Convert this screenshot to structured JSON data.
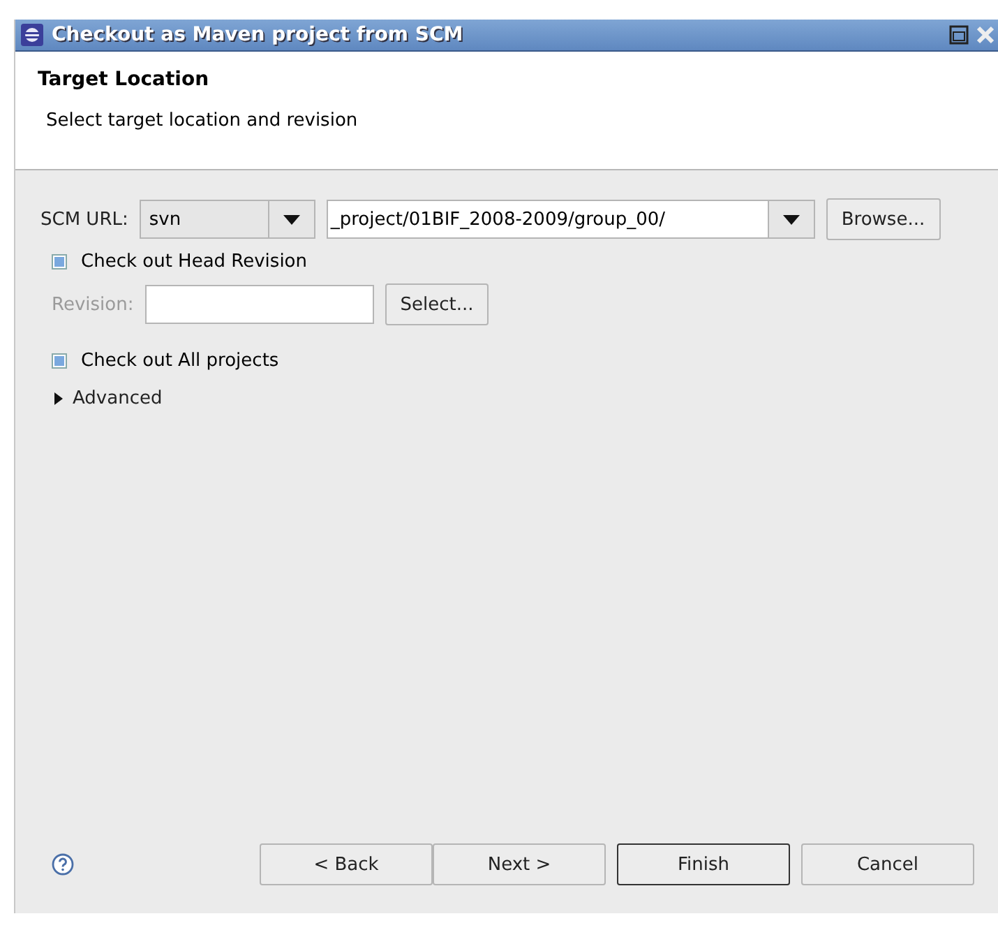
{
  "window": {
    "title": "Checkout as Maven project from SCM"
  },
  "header": {
    "title": "Target Location",
    "subtitle": "Select target location and revision"
  },
  "scm": {
    "label": "SCM URL:",
    "type": "svn",
    "url": "_project/01BIF_2008-2009/group_00/",
    "browse": "Browse..."
  },
  "head_revision": {
    "label": "Check out Head Revision",
    "checked": true
  },
  "revision": {
    "label": "Revision:",
    "disabled": true,
    "select": "Select..."
  },
  "all_projects": {
    "label": "Check out All projects",
    "checked": true
  },
  "advanced": {
    "label": "Advanced",
    "expanded": false
  },
  "buttons": [
    {
      "label": "< Back",
      "default": false
    },
    {
      "label": "Next >",
      "default": false
    },
    {
      "label": "Finish",
      "default": true
    },
    {
      "label": "Cancel",
      "default": false
    }
  ]
}
